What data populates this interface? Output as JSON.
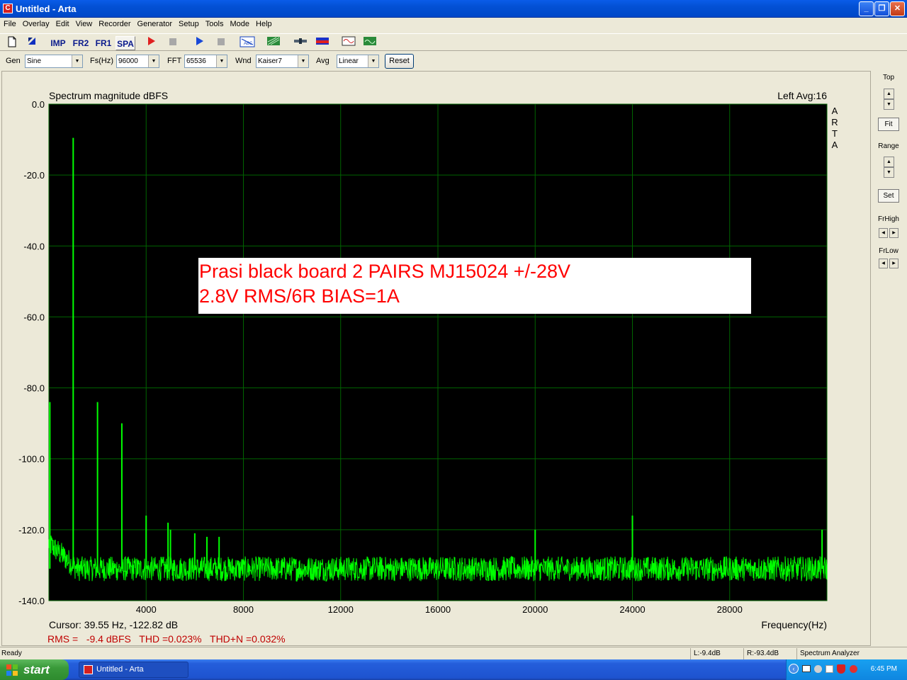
{
  "window": {
    "title": "Untitled - Arta",
    "app_icon_letter": "C"
  },
  "menu": [
    "File",
    "Overlay",
    "Edit",
    "View",
    "Recorder",
    "Generator",
    "Setup",
    "Tools",
    "Mode",
    "Help"
  ],
  "toolbar": {
    "imp": "IMP",
    "fr2": "FR2",
    "fr1": "FR1",
    "spa": "SPA",
    "abc": "ABC"
  },
  "controls": {
    "gen_label": "Gen",
    "gen_value": "Sine",
    "fs_label": "Fs(Hz)",
    "fs_value": "96000",
    "fft_label": "FFT",
    "fft_value": "65536",
    "wnd_label": "Wnd",
    "wnd_value": "Kaiser7",
    "avg_label": "Avg",
    "avg_value": "Linear",
    "reset_label": "Reset"
  },
  "plot": {
    "title": "Spectrum magnitude dBFS",
    "channel_info": "Left  Avg:16",
    "brand": [
      "A",
      "R",
      "T",
      "A"
    ],
    "annotation_line1": "Prasi black board 2 PAIRS MJ15024 +/-28V",
    "annotation_line2": "2.8V RMS/6R BIAS=1A",
    "cursor_readout": "Cursor: 39.55 Hz, -122.82 dB",
    "xlabel": "Frequency(Hz)",
    "measure": "RMS =   -9.4 dBFS   THD =0.023%   THD+N =0.032%"
  },
  "chart_data": {
    "type": "line",
    "title": "Spectrum magnitude dBFS",
    "xlabel": "Frequency(Hz)",
    "ylabel": "",
    "xlim": [
      0,
      32000
    ],
    "ylim": [
      -140,
      0
    ],
    "x_ticks": [
      4000,
      8000,
      12000,
      16000,
      20000,
      24000,
      28000
    ],
    "y_ticks": [
      "0.0",
      "-20.0",
      "-40.0",
      "-60.0",
      "-80.0",
      "-100.0",
      "-120.0",
      "-140.0"
    ],
    "grid": true,
    "line_color": "#00ff00",
    "background": "#000000",
    "grid_color": "#006400",
    "noise_floor_db": -131,
    "peaks": [
      {
        "x": 40,
        "y": -84
      },
      {
        "x": 1000,
        "y": -9.5
      },
      {
        "x": 2000,
        "y": -84
      },
      {
        "x": 3000,
        "y": -90
      },
      {
        "x": 4000,
        "y": -116
      },
      {
        "x": 4900,
        "y": -118
      },
      {
        "x": 5000,
        "y": -120
      },
      {
        "x": 6000,
        "y": -121
      },
      {
        "x": 6500,
        "y": -122
      },
      {
        "x": 7000,
        "y": -122
      },
      {
        "x": 20000,
        "y": -120
      },
      {
        "x": 24000,
        "y": -116
      },
      {
        "x": 31800,
        "y": -120
      }
    ]
  },
  "right_panel": {
    "top": "Top",
    "fit": "Fit",
    "range": "Range",
    "set": "Set",
    "frhigh": "FrHigh",
    "frlow": "FrLow"
  },
  "status": {
    "ready": "Ready",
    "left": "L:-9.4dB",
    "right": "R:-93.4dB",
    "mode": "Spectrum Analyzer"
  },
  "taskbar": {
    "start": "start",
    "task": "Untitled - Arta",
    "clock": "6:45 PM"
  }
}
